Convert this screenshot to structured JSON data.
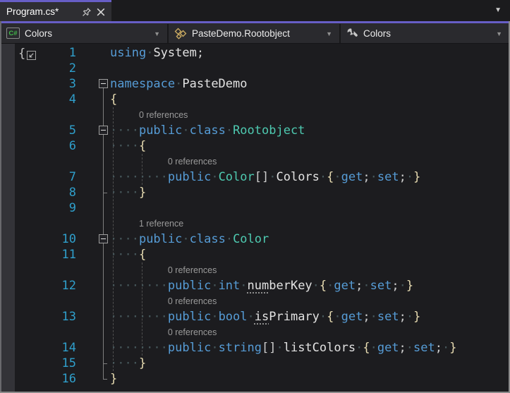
{
  "tab_bar": {
    "tab_title": "Program.cs*",
    "close_glyph": "×",
    "well_caret_glyph": "▼"
  },
  "navbar": {
    "caret_glyph": "▼",
    "project_dropdown": {
      "label": "Colors",
      "icon": "csharp-project-icon",
      "badge_text": "C#"
    },
    "type_dropdown": {
      "label": "PasteDemo.Rootobject",
      "icon": "class-icon"
    },
    "member_dropdown": {
      "label": "Colors",
      "icon": "wrench-member-icon"
    }
  },
  "colors": {
    "accent": "#675EC6",
    "keyword": "#569CD6",
    "type_name": "#4EC9B0",
    "identifier": "#E2E2E2",
    "punctuation": "#CDCDCD",
    "brace": "#E8DCB2",
    "whitespace_dot": "#47585C",
    "line_number": "#2F9FCB",
    "codelens": "#9A9A9A",
    "editor_bg": "#1C1C1F",
    "tab_bg": "#2E2E32",
    "navbar_bg": "#2A2A2E"
  },
  "editor": {
    "rows": [
      {
        "t": "code",
        "n": "1",
        "tokens": [
          [
            "kw",
            "using"
          ],
          [
            "ws",
            " "
          ],
          [
            "id",
            "System"
          ],
          [
            "pu",
            ";"
          ]
        ]
      },
      {
        "t": "code",
        "n": "2",
        "tokens": []
      },
      {
        "t": "code",
        "n": "3",
        "fold": true,
        "tokens": [
          [
            "kw",
            "namespace"
          ],
          [
            "ws",
            " "
          ],
          [
            "id",
            "PasteDemo"
          ]
        ]
      },
      {
        "t": "code",
        "n": "4",
        "tokens": [
          [
            "br",
            "{"
          ]
        ]
      },
      {
        "t": "lens",
        "indent": 4,
        "text": "0 references"
      },
      {
        "t": "code",
        "n": "5",
        "fold": true,
        "tokens": [
          [
            "ws",
            "    "
          ],
          [
            "kw",
            "public"
          ],
          [
            "ws",
            " "
          ],
          [
            "kw",
            "class"
          ],
          [
            "ws",
            " "
          ],
          [
            "cls",
            "Rootobject"
          ]
        ]
      },
      {
        "t": "code",
        "n": "6",
        "tokens": [
          [
            "ws",
            "    "
          ],
          [
            "br",
            "{"
          ]
        ]
      },
      {
        "t": "lens",
        "indent": 8,
        "text": "0 references"
      },
      {
        "t": "code",
        "n": "7",
        "tokens": [
          [
            "ws",
            "        "
          ],
          [
            "kw",
            "public"
          ],
          [
            "ws",
            " "
          ],
          [
            "cls",
            "Color"
          ],
          [
            "pu",
            "[]"
          ],
          [
            "ws",
            " "
          ],
          [
            "id",
            "Colors"
          ],
          [
            "ws",
            " "
          ],
          [
            "br",
            "{"
          ],
          [
            "ws",
            " "
          ],
          [
            "kw",
            "get"
          ],
          [
            "pu",
            ";"
          ],
          [
            "ws",
            " "
          ],
          [
            "kw",
            "set"
          ],
          [
            "pu",
            ";"
          ],
          [
            "ws",
            " "
          ],
          [
            "br",
            "}"
          ]
        ]
      },
      {
        "t": "code",
        "n": "8",
        "tokens": [
          [
            "ws",
            "    "
          ],
          [
            "br",
            "}"
          ]
        ]
      },
      {
        "t": "code",
        "n": "9",
        "tokens": []
      },
      {
        "t": "lens",
        "indent": 4,
        "text": "1 reference"
      },
      {
        "t": "code",
        "n": "10",
        "fold": true,
        "tokens": [
          [
            "ws",
            "    "
          ],
          [
            "kw",
            "public"
          ],
          [
            "ws",
            " "
          ],
          [
            "kw",
            "class"
          ],
          [
            "ws",
            " "
          ],
          [
            "cls",
            "Color"
          ]
        ]
      },
      {
        "t": "code",
        "n": "11",
        "tokens": [
          [
            "ws",
            "    "
          ],
          [
            "br",
            "{"
          ]
        ]
      },
      {
        "t": "lens",
        "indent": 8,
        "text": "0 references"
      },
      {
        "t": "code",
        "n": "12",
        "tokens": [
          [
            "ws",
            "        "
          ],
          [
            "kw",
            "public"
          ],
          [
            "ws",
            " "
          ],
          [
            "kw",
            "int"
          ],
          [
            "ws",
            " "
          ],
          [
            "id",
            "numberKey",
            "u3"
          ],
          [
            "ws",
            " "
          ],
          [
            "br",
            "{"
          ],
          [
            "ws",
            " "
          ],
          [
            "kw",
            "get"
          ],
          [
            "pu",
            ";"
          ],
          [
            "ws",
            " "
          ],
          [
            "kw",
            "set"
          ],
          [
            "pu",
            ";"
          ],
          [
            "ws",
            " "
          ],
          [
            "br",
            "}"
          ]
        ]
      },
      {
        "t": "lens",
        "indent": 8,
        "text": "0 references"
      },
      {
        "t": "code",
        "n": "13",
        "tokens": [
          [
            "ws",
            "        "
          ],
          [
            "kw",
            "public"
          ],
          [
            "ws",
            " "
          ],
          [
            "kw",
            "bool"
          ],
          [
            "ws",
            " "
          ],
          [
            "id",
            "isPrimary",
            "u2"
          ],
          [
            "ws",
            " "
          ],
          [
            "br",
            "{"
          ],
          [
            "ws",
            " "
          ],
          [
            "kw",
            "get"
          ],
          [
            "pu",
            ";"
          ],
          [
            "ws",
            " "
          ],
          [
            "kw",
            "set"
          ],
          [
            "pu",
            ";"
          ],
          [
            "ws",
            " "
          ],
          [
            "br",
            "}"
          ]
        ]
      },
      {
        "t": "lens",
        "indent": 8,
        "text": "0 references"
      },
      {
        "t": "code",
        "n": "14",
        "tokens": [
          [
            "ws",
            "        "
          ],
          [
            "kw",
            "public"
          ],
          [
            "ws",
            " "
          ],
          [
            "kw",
            "string"
          ],
          [
            "pu",
            "[]"
          ],
          [
            "ws",
            " "
          ],
          [
            "id",
            "listColors"
          ],
          [
            "ws",
            " "
          ],
          [
            "br",
            "{"
          ],
          [
            "ws",
            " "
          ],
          [
            "kw",
            "get"
          ],
          [
            "pu",
            ";"
          ],
          [
            "ws",
            " "
          ],
          [
            "kw",
            "set"
          ],
          [
            "pu",
            ";"
          ],
          [
            "ws",
            " "
          ],
          [
            "br",
            "}"
          ]
        ]
      },
      {
        "t": "code",
        "n": "15",
        "tokens": [
          [
            "ws",
            "    "
          ],
          [
            "br",
            "}"
          ]
        ]
      },
      {
        "t": "code",
        "n": "16",
        "tokens": [
          [
            "br",
            "}"
          ]
        ]
      }
    ]
  }
}
